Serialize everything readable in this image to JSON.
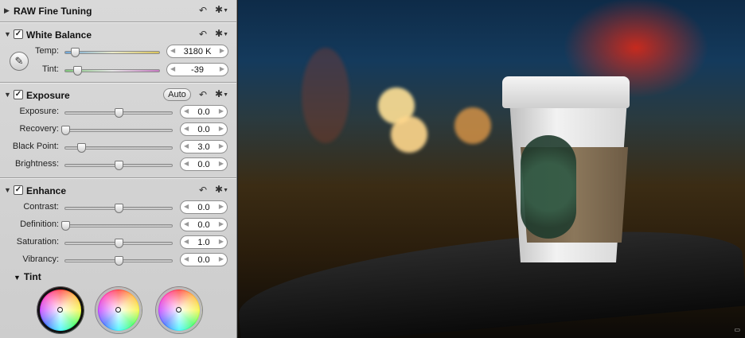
{
  "raw_fine_tuning": {
    "title": "RAW Fine Tuning"
  },
  "white_balance": {
    "title": "White Balance",
    "temp": {
      "label": "Temp:",
      "value": "3180 K",
      "level": 0.1
    },
    "tint": {
      "label": "Tint:",
      "value": "-39",
      "level": 0.13
    }
  },
  "exposure": {
    "title": "Exposure",
    "auto_label": "Auto",
    "rows": [
      {
        "label": "Exposure:",
        "value": "0.0",
        "level": 0.5
      },
      {
        "label": "Recovery:",
        "value": "0.0",
        "level": 0.0
      },
      {
        "label": "Black Point:",
        "value": "3.0",
        "level": 0.15
      },
      {
        "label": "Brightness:",
        "value": "0.0",
        "level": 0.5
      }
    ]
  },
  "enhance": {
    "title": "Enhance",
    "rows": [
      {
        "label": "Contrast:",
        "value": "0.0",
        "level": 0.5
      },
      {
        "label": "Definition:",
        "value": "0.0",
        "level": 0.0
      },
      {
        "label": "Saturation:",
        "value": "1.0",
        "level": 0.5
      },
      {
        "label": "Vibrancy:",
        "value": "0.0",
        "level": 0.5
      }
    ],
    "tint_title": "Tint"
  },
  "icons": {
    "undo": "↶",
    "gear": "✱",
    "disclosure_open": "▼",
    "disclosure_closed": "▶",
    "check": "✓",
    "eyedropper": "✎",
    "arrow_left": "◀",
    "arrow_right": "▶",
    "viewer": "▭"
  },
  "colors": {
    "panel_bg": "#d4d4d4",
    "photo_sky": "#143a5c",
    "accent_red": "#e62814"
  }
}
